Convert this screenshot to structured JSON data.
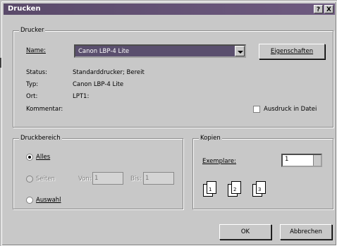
{
  "window": {
    "title": "Drucken",
    "help_btn": "?",
    "close_btn": "X"
  },
  "printer": {
    "group_label": "Drucker",
    "name_label": "Name:",
    "name_value": "Canon LBP-4 Lite",
    "properties_button": "Eigenschaften",
    "status_label": "Status:",
    "status_value": "Standarddrucker; Bereit",
    "type_label": "Typ:",
    "type_value": "Canon LBP-4 Lite",
    "location_label": "Ort:",
    "location_value": "LPT1:",
    "comment_label": "Kommentar:",
    "print_to_file_label": "Ausdruck in Datei"
  },
  "range": {
    "group_label": "Druckbereich",
    "all_label": "Alles",
    "pages_label": "Seiten",
    "from_label": "Von:",
    "from_value": "1",
    "to_label": "Bis:",
    "to_value": "1",
    "selection_label": "Auswahl"
  },
  "copies": {
    "group_label": "Kopien",
    "count_label": "Exemplare:",
    "count_value": "1",
    "collate_pages": [
      "1",
      "2",
      "3"
    ]
  },
  "footer": {
    "ok": "OK",
    "cancel": "Abbrechen"
  }
}
